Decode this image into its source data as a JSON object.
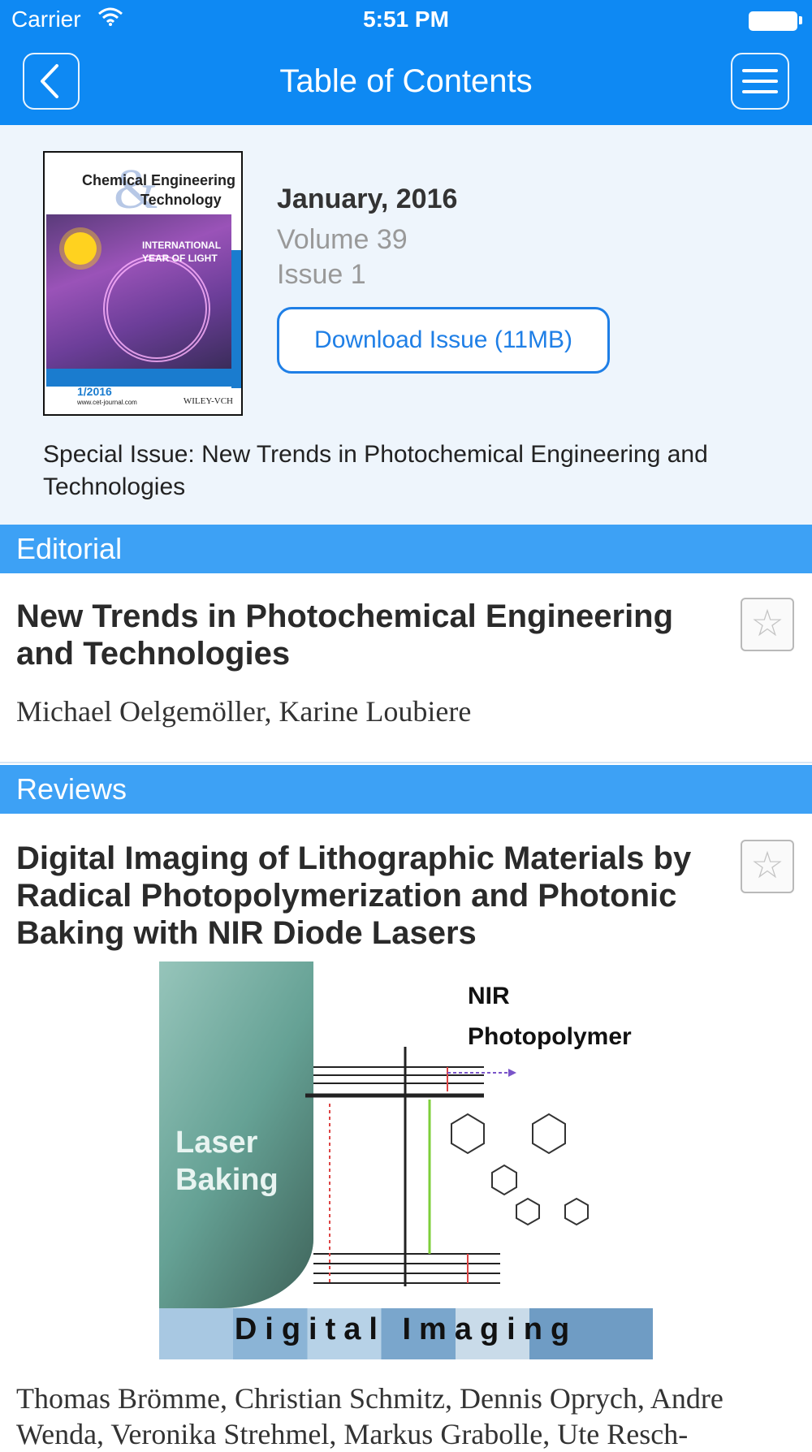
{
  "status_bar": {
    "carrier": "Carrier",
    "time": "5:51 PM"
  },
  "nav": {
    "title": "Table of Contents",
    "back_icon": "chevron-left-icon",
    "menu_icon": "hamburger-menu-icon"
  },
  "issue": {
    "cover": {
      "journal_line1": "Chemical Engineering",
      "journal_line2": "Technology",
      "banner": "INTERNATIONAL YEAR OF LIGHT",
      "issue_label": "1/2016",
      "url": "www.cet-journal.com",
      "publisher": "WILEY-VCH"
    },
    "date": "January, 2016",
    "volume": "Volume 39",
    "issue": "Issue 1",
    "download_label": "Download Issue (11MB)",
    "special_issue": "Special Issue: New Trends in Photochemical Engineering and Technologies"
  },
  "sections": [
    {
      "title": "Editorial",
      "articles": [
        {
          "title": "New Trends in Photochemical Engineering and Technologies",
          "authors": "Michael Oelgemöller, Karine Loubiere"
        }
      ]
    },
    {
      "title": "Reviews",
      "articles": [
        {
          "title": "Digital Imaging of Lithographic Materials by Radical Photopolymerization and Photonic Baking with NIR Diode Lasers",
          "abstract_labels": {
            "laser": "Laser Baking",
            "nir_line1": "NIR",
            "nir_line2": "Photopolymer",
            "bottom": "Digital Imaging"
          },
          "authors": "Thomas Brömme, Christian Schmitz, Dennis Oprych, Andre Wenda, Veronika Strehmel, Markus Grabolle, Ute Resch-"
        }
      ]
    }
  ],
  "colors": {
    "nav_bar": "#0e89f3",
    "section_header": "#3da1f5",
    "issue_panel": "#eef5fc",
    "accent": "#1f7fe6"
  }
}
